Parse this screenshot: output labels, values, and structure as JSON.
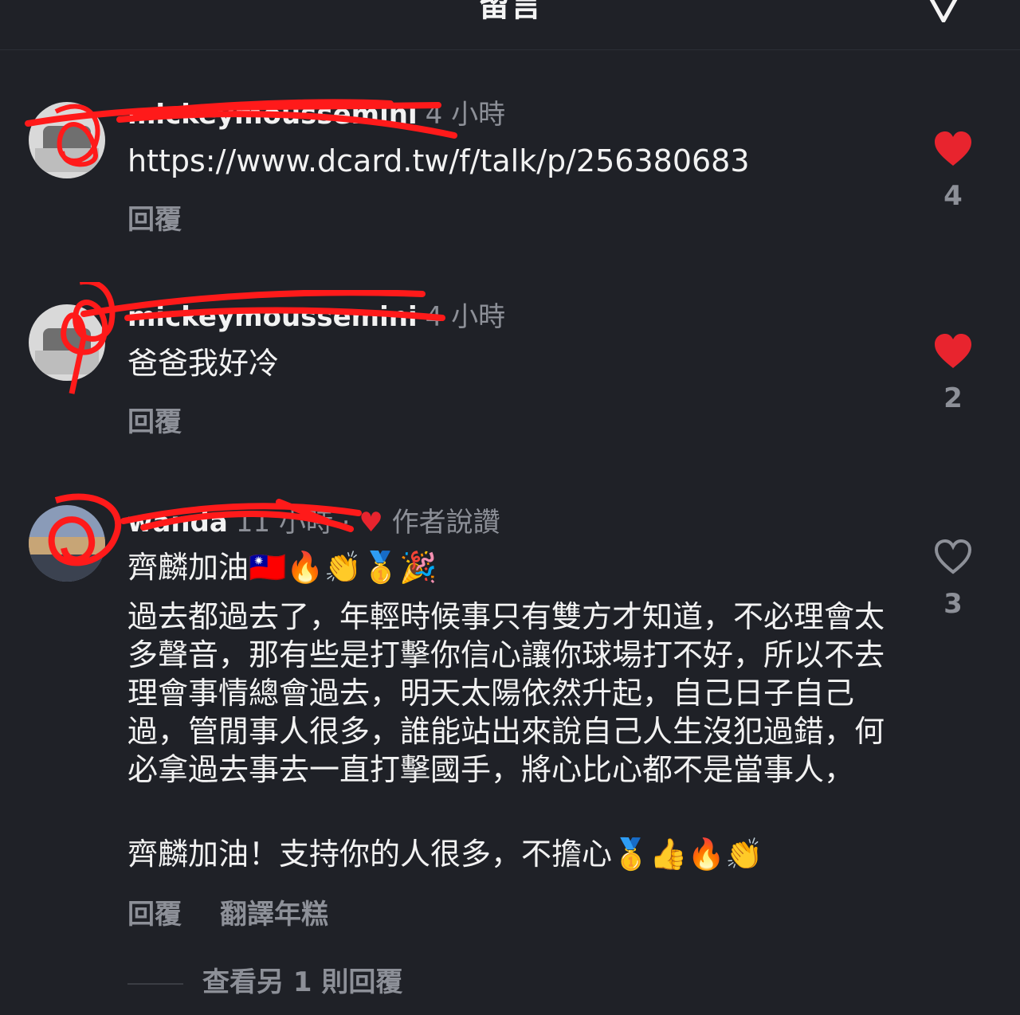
{
  "header": {
    "title": "留言"
  },
  "comments": [
    {
      "username": "mickeymoussemini",
      "time": "4 小時",
      "text": "https://www.dcard.tw/f/talk/p/256380683",
      "reply_label": "回覆",
      "like_count": "4",
      "liked": true
    },
    {
      "username": "mickeymoussemini",
      "time": "4 小時",
      "text": "爸爸我好冷",
      "reply_label": "回覆",
      "like_count": "2",
      "liked": true
    },
    {
      "username": "wanda",
      "time": "11 小時",
      "author_liked_label": "作者說讚",
      "line1": "齊麟加油🇹🇼🔥👏🥇🎉",
      "paragraph": "過去都過去了，年輕時候事只有雙方才知道，不必理會太多聲音，那有些是打擊你信心讓你球場打不好，所以不去理會事情總會過去，明天太陽依然升起，自己日子自己過，管閒事人很多，誰能站出來說自己人生沒犯過錯，何必拿過去事去一直打擊國手，將心比心都不是當事人，",
      "line_last": "齊麟加油！支持你的人很多，不擔心🥇👍🔥👏",
      "reply_label": "回覆",
      "translate_label": "翻譯年糕",
      "like_count": "3",
      "liked": false
    }
  ],
  "view_more_label": "查看另 1 則回覆",
  "colors": {
    "background": "#1f2127",
    "heart_red": "#e8242e",
    "secondary_text": "#8d9098",
    "scribble_red": "#ff1a1a"
  }
}
